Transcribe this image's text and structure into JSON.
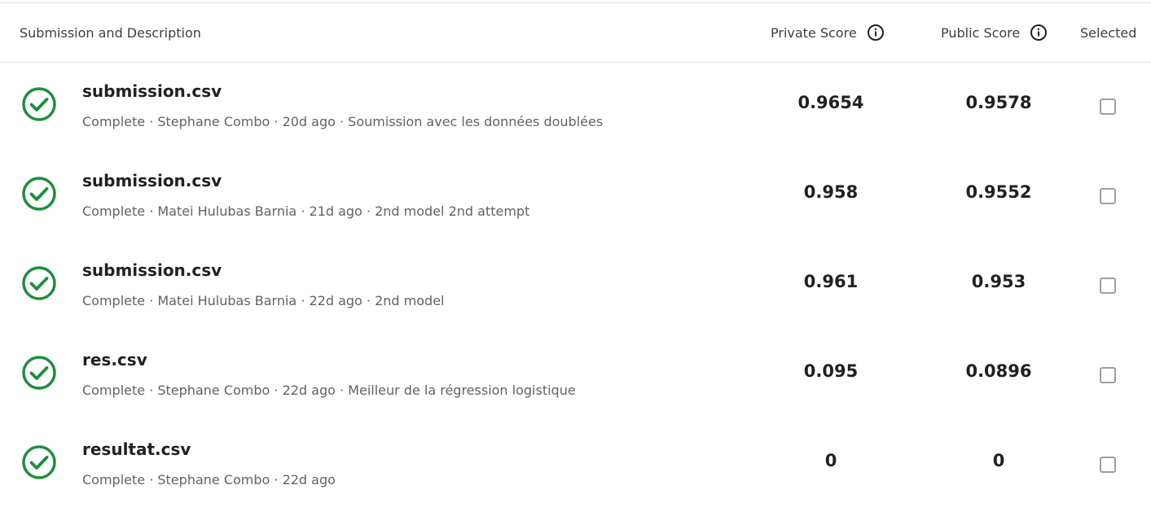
{
  "header": {
    "description_label": "Submission and Description",
    "private_score_label": "Private Score",
    "public_score_label": "Public Score",
    "selected_label": "Selected"
  },
  "colors": {
    "success_green": "#1e8e3e",
    "text_primary": "#202124",
    "text_secondary": "#5f6368",
    "divider": "#dadce0"
  },
  "submissions": [
    {
      "file": "submission.csv",
      "meta": "Complete · Stephane Combo · 20d ago · Soumission avec les données doublées",
      "private": "0.9654",
      "public": "0.9578",
      "status_icon": "check-circle-icon",
      "selected": false
    },
    {
      "file": "submission.csv",
      "meta": "Complete · Matei Hulubas Barnia · 21d ago · 2nd model 2nd attempt",
      "private": "0.958",
      "public": "0.9552",
      "status_icon": "check-circle-icon",
      "selected": false
    },
    {
      "file": "submission.csv",
      "meta": "Complete · Matei Hulubas Barnia · 22d ago · 2nd model",
      "private": "0.961",
      "public": "0.953",
      "status_icon": "check-circle-icon",
      "selected": false
    },
    {
      "file": "res.csv",
      "meta": "Complete · Stephane Combo · 22d ago · Meilleur de la régression logistique",
      "private": "0.095",
      "public": "0.0896",
      "status_icon": "check-circle-icon",
      "selected": false
    },
    {
      "file": "resultat.csv",
      "meta": "Complete · Stephane Combo · 22d ago",
      "private": "0",
      "public": "0",
      "status_icon": "check-circle-icon",
      "selected": false
    }
  ]
}
